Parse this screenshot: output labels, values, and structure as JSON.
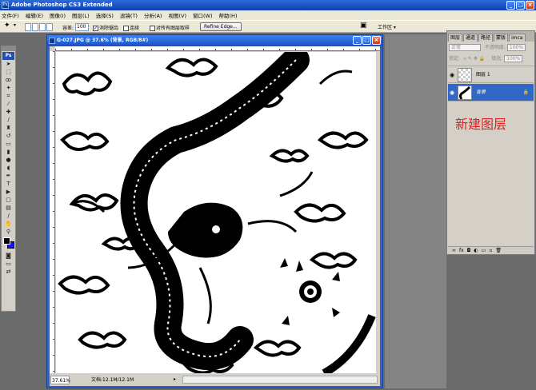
{
  "app": {
    "title": "Adobe Photoshop CS3 Extended",
    "icon": "ps-app-icon"
  },
  "menu": [
    "文件(F)",
    "编辑(E)",
    "图像(I)",
    "图层(L)",
    "选择(S)",
    "滤镜(T)",
    "分析(A)",
    "视图(V)",
    "窗口(W)",
    "帮助(H)"
  ],
  "options": {
    "feather_label": "容差:",
    "feather_value": "100",
    "antialias_label": "消除锯齿",
    "contiguous_label": "连续",
    "all_layers_label": "对所有图层取样",
    "refine_label": "Refine Edge...",
    "workspace_label": "工作区 ▾"
  },
  "toolbox": {
    "logo": "Ps"
  },
  "document": {
    "title": "G-027.JPG @ 37.6% (背景, RGB/8#)",
    "zoom": "37.61%",
    "file_info": "文档:12.1M/12.1M",
    "status_arrow": "▸"
  },
  "layers_panel": {
    "tabs": [
      "图层",
      "通道",
      "路径",
      "蒙版",
      "imca"
    ],
    "blend_mode": "正常",
    "opacity_label": "不透明度:",
    "opacity_value": "100%",
    "lock_label": "锁定:",
    "fill_label": "填充:",
    "fill_value": "100%",
    "layers": [
      {
        "name": "图层 1",
        "selected": false
      },
      {
        "name": "背景",
        "selected": true
      }
    ],
    "footer_icons": [
      "link-icon",
      "fx-icon",
      "mask-icon",
      "adjustment-icon",
      "group-icon",
      "new-layer-icon",
      "trash-icon"
    ],
    "footer_labels": [
      "∞",
      "fx",
      "◘",
      "◐",
      "▭",
      "▫",
      "🗑"
    ]
  },
  "annotation": "新建图层",
  "colors": {
    "xp_blue": "#2d62cf",
    "selection": "#3168c5",
    "annotation": "#e02020"
  }
}
